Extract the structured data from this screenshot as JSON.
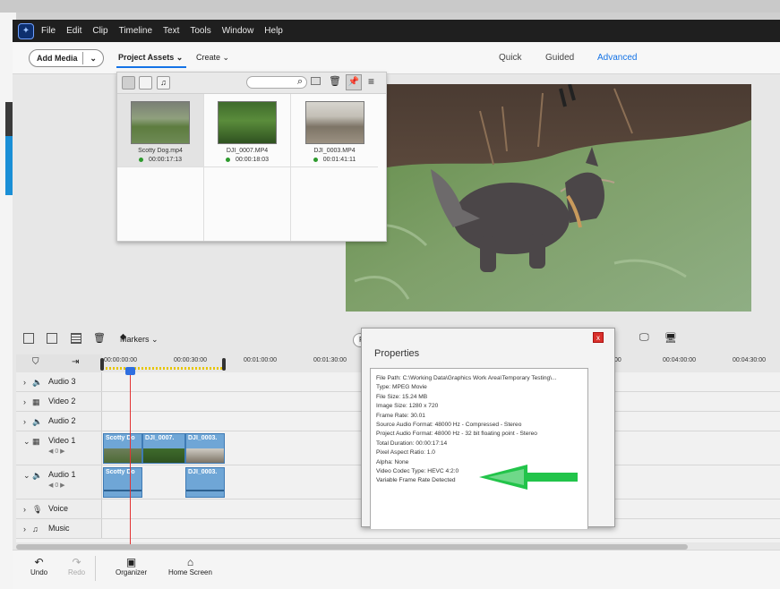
{
  "menu": {
    "items": [
      "File",
      "Edit",
      "Clip",
      "Timeline",
      "Text",
      "Tools",
      "Window",
      "Help"
    ]
  },
  "toolbar": {
    "add_media": "Add Media",
    "project_assets": "Project Assets",
    "create": "Create",
    "modes": [
      "Quick",
      "Guided",
      "Advanced"
    ],
    "active_mode": "Advanced"
  },
  "assets": {
    "items": [
      {
        "name": "Scotty Dog.mp4",
        "duration": "00:00:17:13"
      },
      {
        "name": "DJI_0007.MP4",
        "duration": "00:00:18:03"
      },
      {
        "name": "DJI_0003.MP4",
        "duration": "00:01:41:11"
      }
    ]
  },
  "timeline": {
    "markers_label": "Markers",
    "partial_button_label": "Re",
    "ruler_ticks": [
      "00:00:00:00",
      "00:00:30:00",
      "00:01:00:00",
      "00:01:30:00",
      "00:04:00:00",
      "00:04:30:00"
    ],
    "partial_tick": "00",
    "tracks": [
      {
        "name": "Audio 3"
      },
      {
        "name": "Video 2"
      },
      {
        "name": "Audio 2"
      },
      {
        "name": "Video 1",
        "sub": "◀ 0 ▶"
      },
      {
        "name": "Audio 1",
        "sub": "◀ 0 ▶"
      },
      {
        "name": "Voice"
      },
      {
        "name": "Music"
      }
    ],
    "video1_clips": [
      "Scotty Do",
      "DJI_0007.",
      "DJI_0003."
    ],
    "audio1_clips": [
      "Scotty Do",
      "DJI_0003."
    ]
  },
  "bottom": {
    "undo": "Undo",
    "redo": "Redo",
    "organizer": "Organizer",
    "home": "Home Screen"
  },
  "properties": {
    "title": "Properties",
    "close": "x",
    "lines": [
      "File Path: C:\\Working Data\\Graphics Work Area\\Temporary Testing\\...",
      "Type: MPEG Movie",
      "File Size: 15.24 MB",
      "Image Size: 1280 x 720",
      "Frame Rate: 30.01",
      "Source Audio Format: 48000 Hz - Compressed - Stereo",
      "Project Audio Format: 48000 Hz - 32 bit floating point - Stereo",
      "Total Duration: 00:00:17:14",
      "Pixel Aspect Ratio: 1.0",
      "Alpha: None",
      "Video Codec Type: HEVC 4:2:0",
      "Variable Frame Rate Detected"
    ]
  },
  "colors": {
    "accent": "#1473e6",
    "arrow": "#22c44a",
    "clip": "#6fa6d6",
    "playhead": "#e23333"
  }
}
